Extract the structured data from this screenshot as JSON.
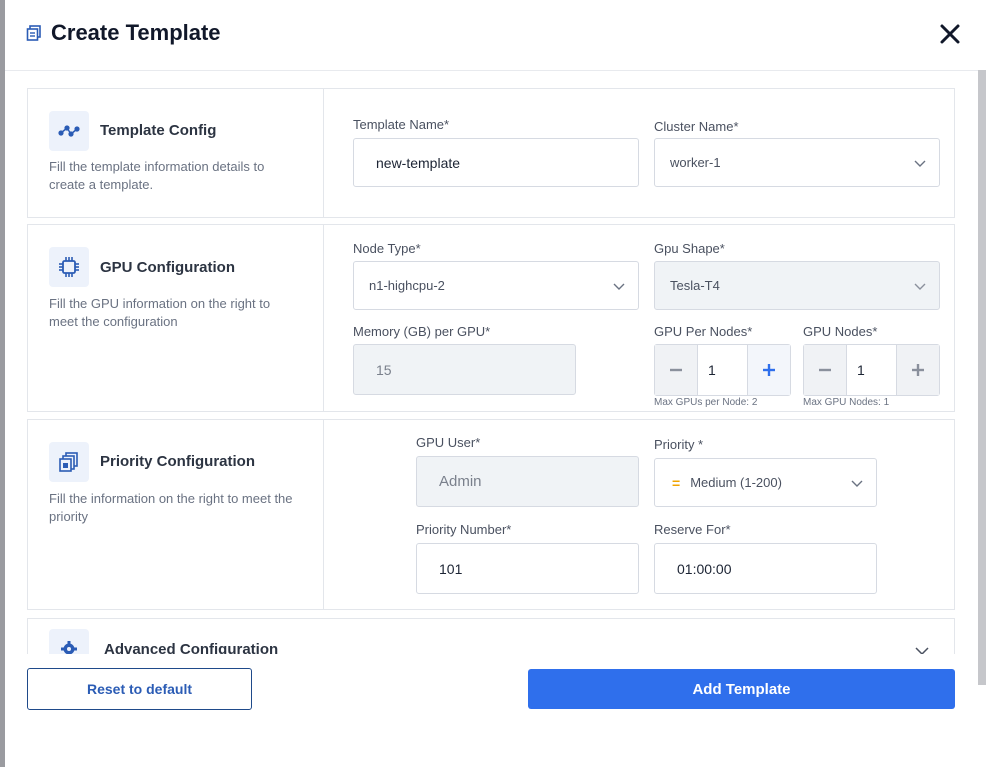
{
  "header": {
    "title": "Create Template"
  },
  "sections": {
    "template": {
      "title": "Template Config",
      "desc": "Fill the template information details to create a template.",
      "template_name_label": "Template Name*",
      "template_name_value": "new-template",
      "cluster_label": "Cluster Name*",
      "cluster_value": "worker-1"
    },
    "gpu": {
      "title": "GPU Configuration",
      "desc": "Fill the GPU information on the right to meet the configuration",
      "node_type_label": "Node Type*",
      "node_type_value": "n1-highcpu-2",
      "gpu_shape_label": "Gpu Shape*",
      "gpu_shape_value": "Tesla-T4",
      "memory_label": "Memory (GB) per GPU*",
      "memory_value": "15",
      "per_nodes_label": "GPU Per Nodes*",
      "per_nodes_value": "1",
      "per_nodes_hint": "Max GPUs per Node: 2",
      "gpu_nodes_label": "GPU Nodes*",
      "gpu_nodes_value": "1",
      "gpu_nodes_hint": "Max GPU Nodes: 1"
    },
    "priority": {
      "title": "Priority Configuration",
      "desc": "Fill the information on the right to meet the priority",
      "gpu_user_label": "GPU User*",
      "gpu_user_value": "Admin",
      "priority_label": "Priority *",
      "priority_value": "Medium (1-200)",
      "priority_number_label": "Priority Number*",
      "priority_number_value": "101",
      "reserve_label": "Reserve For*",
      "reserve_value": "01:00:00"
    },
    "advanced": {
      "title": "Advanced Configuration"
    }
  },
  "footer": {
    "reset_label": "Reset to default",
    "add_label": "Add Template"
  },
  "colors": {
    "primary": "#2f6fec",
    "accent_icon": "#2b5cb5",
    "priority_medium": "#f0a400"
  },
  "icons": [
    "template-copy-icon",
    "close-icon",
    "workflow-icon",
    "cpu-chip-icon",
    "stack-icon",
    "gear-icon",
    "chevron-down-icon",
    "minus-icon",
    "plus-icon"
  ]
}
